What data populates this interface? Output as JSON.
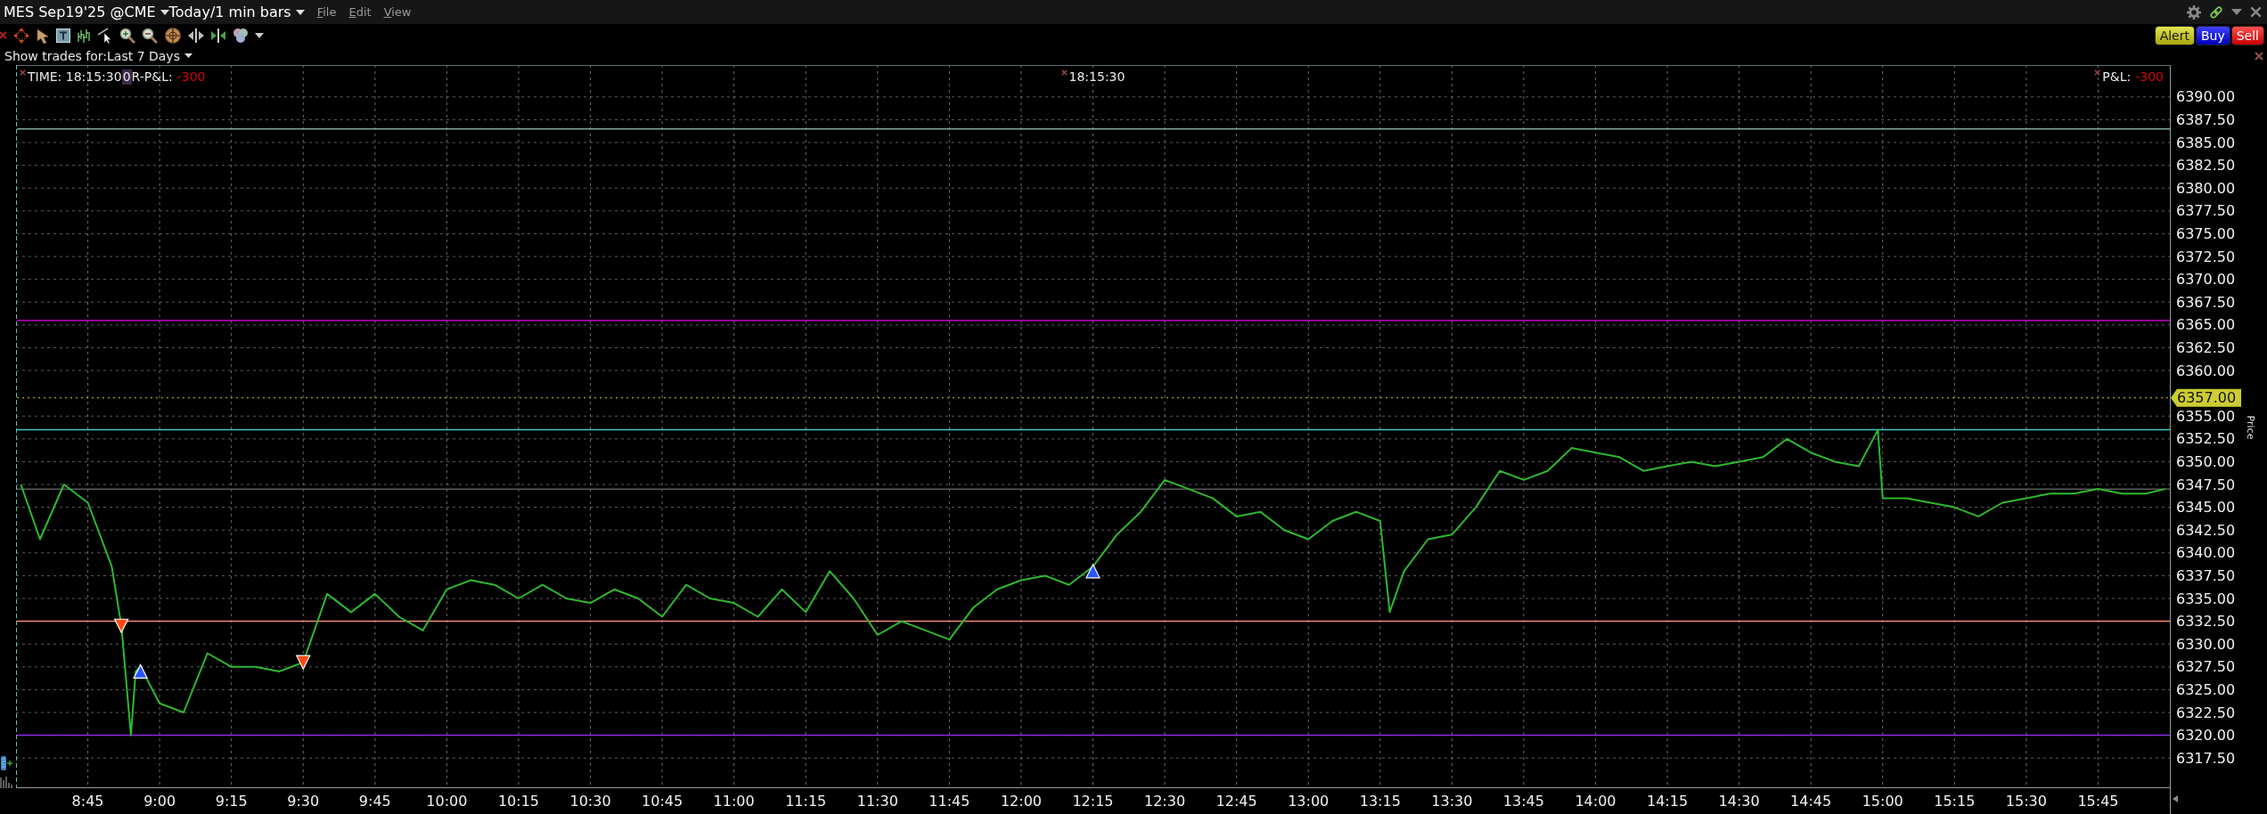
{
  "title_bar": {
    "instrument": "MES Sep19'25 @CME",
    "period": "Today/1 min bars",
    "menu": [
      "File",
      "Edit",
      "View"
    ]
  },
  "order_buttons": [
    {
      "label": "Alert",
      "kind": "alert"
    },
    {
      "label": "Buy",
      "kind": "buy"
    },
    {
      "label": "Sell",
      "kind": "sell"
    }
  ],
  "trades_filter": {
    "label": "Show trades for:",
    "value": "Last 7 Days"
  },
  "chart": {
    "readout_left": {
      "time": "TIME: 18:15:30",
      "badge": "0",
      "label": "R-P&L:",
      "value": "-300"
    },
    "readout_center": {
      "time": "18:15:30"
    },
    "readout_right": {
      "label": "P&L:",
      "value": "-300"
    },
    "axis_title": "Price",
    "chart_data": {
      "type": "line",
      "grid": true,
      "x": [
        511,
        515,
        520,
        525,
        530,
        532,
        534,
        535,
        536,
        540,
        545,
        550,
        555,
        560,
        565,
        570,
        575,
        580,
        585,
        590,
        595,
        600,
        605,
        610,
        615,
        620,
        625,
        630,
        635,
        640,
        645,
        650,
        655,
        660,
        665,
        670,
        675,
        680,
        685,
        690,
        695,
        700,
        705,
        710,
        715,
        720,
        725,
        730,
        735,
        740,
        745,
        750,
        755,
        760,
        765,
        770,
        775,
        780,
        785,
        790,
        795,
        797,
        800,
        805,
        810,
        815,
        820,
        825,
        830,
        835,
        840,
        845,
        850,
        855,
        860,
        865,
        870,
        875,
        880,
        885,
        890,
        895,
        899,
        900,
        905,
        910,
        915,
        920,
        925,
        930,
        935,
        940,
        945,
        950,
        955,
        959
      ],
      "series": [
        {
          "color": "#2eb82e",
          "values": [
            6347.5,
            6341.5,
            6347.5,
            6345.5,
            6338.5,
            6332.0,
            6320.0,
            6327.0,
            6327.5,
            6323.5,
            6322.5,
            6329.0,
            6327.5,
            6327.5,
            6327.0,
            6328.0,
            6335.5,
            6333.5,
            6335.5,
            6333.0,
            6331.5,
            6336.0,
            6337.0,
            6336.5,
            6335.0,
            6336.5,
            6335.0,
            6334.5,
            6336.0,
            6335.0,
            6333.0,
            6336.5,
            6335.0,
            6334.5,
            6333.0,
            6336.0,
            6333.5,
            6338.0,
            6335.0,
            6331.0,
            6332.5,
            6331.5,
            6330.5,
            6334.0,
            6336.0,
            6337.0,
            6337.5,
            6336.5,
            6338.5,
            6342.0,
            6344.5,
            6348.0,
            6347.0,
            6346.0,
            6344.0,
            6344.5,
            6342.5,
            6341.5,
            6343.5,
            6344.5,
            6343.5,
            6333.5,
            6338.0,
            6341.5,
            6342.0,
            6345.0,
            6349.0,
            6348.0,
            6349.0,
            6351.5,
            6351.0,
            6350.5,
            6349.0,
            6349.5,
            6350.0,
            6349.5,
            6350.0,
            6350.5,
            6352.5,
            6351.0,
            6350.0,
            6349.5,
            6353.5,
            6346.0,
            6346.0,
            6345.5,
            6345.0,
            6344.0,
            6345.5,
            6346.0,
            6346.5,
            6346.5,
            6347.0,
            6346.5,
            6346.5,
            6347.0
          ]
        },
        {
          "type": "scatter",
          "marker": "triangle-down",
          "color": "#ff4a12",
          "values": [
            null,
            null,
            null,
            null,
            null,
            6332.0,
            null,
            null,
            null,
            null,
            null,
            null,
            null,
            null,
            null,
            6328.0,
            null,
            null,
            null,
            null,
            null,
            null,
            null,
            null,
            null,
            null,
            null,
            null,
            null,
            null,
            null,
            null,
            null,
            null,
            null,
            null,
            null,
            null,
            null,
            null,
            null,
            null,
            null,
            null,
            null,
            null,
            null,
            null,
            null,
            null,
            null,
            null,
            null,
            null,
            null,
            null,
            null,
            null,
            null,
            null,
            null,
            null,
            null,
            null,
            null,
            null,
            null,
            null,
            null,
            null,
            null,
            null,
            null,
            null,
            null,
            null,
            null,
            null,
            null,
            null,
            null,
            null,
            null,
            null,
            null,
            null,
            null,
            null,
            null,
            null,
            null,
            null,
            null,
            null,
            null,
            null
          ]
        },
        {
          "type": "scatter",
          "marker": "triangle-up",
          "color": "#2a55ff",
          "values": [
            null,
            null,
            null,
            null,
            null,
            null,
            null,
            null,
            6327.0,
            null,
            null,
            null,
            null,
            null,
            null,
            null,
            null,
            null,
            null,
            null,
            null,
            null,
            null,
            null,
            null,
            null,
            null,
            null,
            null,
            null,
            null,
            null,
            null,
            null,
            null,
            null,
            null,
            null,
            null,
            null,
            null,
            null,
            null,
            null,
            null,
            null,
            null,
            null,
            6338.0,
            null,
            null,
            null,
            null,
            null,
            null,
            null,
            null,
            null,
            null,
            null,
            null,
            null,
            null,
            null,
            null,
            null,
            null,
            null,
            null,
            null,
            null,
            null,
            null,
            null,
            null,
            null,
            null,
            null,
            null,
            null,
            null,
            null,
            null,
            null,
            null,
            null,
            null,
            null,
            null,
            null,
            null,
            null,
            null,
            null,
            null,
            null
          ]
        }
      ],
      "xlim": [
        510,
        960
      ],
      "ylim": [
        6314.2,
        6393.5
      ],
      "xticks": [
        {
          "value": 525,
          "label": "8:45"
        },
        {
          "value": 540,
          "label": "9:00"
        },
        {
          "value": 555,
          "label": "9:15"
        },
        {
          "value": 570,
          "label": "9:30"
        },
        {
          "value": 585,
          "label": "9:45"
        },
        {
          "value": 600,
          "label": "10:00"
        },
        {
          "value": 615,
          "label": "10:15"
        },
        {
          "value": 630,
          "label": "10:30"
        },
        {
          "value": 645,
          "label": "10:45"
        },
        {
          "value": 660,
          "label": "11:00"
        },
        {
          "value": 675,
          "label": "11:15"
        },
        {
          "value": 690,
          "label": "11:30"
        },
        {
          "value": 705,
          "label": "11:45"
        },
        {
          "value": 720,
          "label": "12:00"
        },
        {
          "value": 735,
          "label": "12:15"
        },
        {
          "value": 750,
          "label": "12:30"
        },
        {
          "value": 765,
          "label": "12:45"
        },
        {
          "value": 780,
          "label": "13:00"
        },
        {
          "value": 795,
          "label": "13:15"
        },
        {
          "value": 810,
          "label": "13:30"
        },
        {
          "value": 825,
          "label": "13:45"
        },
        {
          "value": 840,
          "label": "14:00"
        },
        {
          "value": 855,
          "label": "14:15"
        },
        {
          "value": 870,
          "label": "14:30"
        },
        {
          "value": 885,
          "label": "14:45"
        },
        {
          "value": 900,
          "label": "15:00"
        },
        {
          "value": 915,
          "label": "15:15"
        },
        {
          "value": 930,
          "label": "15:30"
        },
        {
          "value": 945,
          "label": "15:45"
        }
      ],
      "yticks": [
        {
          "value": 6317.5,
          "label": "6317.50"
        },
        {
          "value": 6320,
          "label": "6320.00"
        },
        {
          "value": 6322.5,
          "label": "6322.50"
        },
        {
          "value": 6325,
          "label": "6325.00"
        },
        {
          "value": 6327.5,
          "label": "6327.50"
        },
        {
          "value": 6330,
          "label": "6330.00"
        },
        {
          "value": 6332.5,
          "label": "6332.50"
        },
        {
          "value": 6335,
          "label": "6335.00"
        },
        {
          "value": 6337.5,
          "label": "6337.50"
        },
        {
          "value": 6340,
          "label": "6340.00"
        },
        {
          "value": 6342.5,
          "label": "6342.50"
        },
        {
          "value": 6345,
          "label": "6345.00"
        },
        {
          "value": 6347.5,
          "label": "6347.50"
        },
        {
          "value": 6350,
          "label": "6350.00"
        },
        {
          "value": 6352.5,
          "label": "6352.50"
        },
        {
          "value": 6355,
          "label": "6355.00"
        },
        {
          "value": 6360,
          "label": "6360.00"
        },
        {
          "value": 6362.5,
          "label": "6362.50"
        },
        {
          "value": 6365,
          "label": "6365.00"
        },
        {
          "value": 6367.5,
          "label": "6367.50"
        },
        {
          "value": 6370,
          "label": "6370.00"
        },
        {
          "value": 6372.5,
          "label": "6372.50"
        },
        {
          "value": 6375,
          "label": "6375.00"
        },
        {
          "value": 6377.5,
          "label": "6377.50"
        },
        {
          "value": 6380,
          "label": "6380.00"
        },
        {
          "value": 6382.5,
          "label": "6382.50"
        },
        {
          "value": 6385,
          "label": "6385.00"
        },
        {
          "value": 6387.5,
          "label": "6387.50"
        },
        {
          "value": 6390,
          "label": "6390.00"
        }
      ],
      "ref_lines": [
        {
          "axis": "y",
          "value": 6386.5,
          "color": "#7fa89a"
        },
        {
          "axis": "y",
          "value": 6365.5,
          "color": "#c000c0"
        },
        {
          "axis": "y",
          "value": 6357,
          "color": "#cccc33",
          "label": "6357.00"
        },
        {
          "axis": "y",
          "value": 6353.5,
          "color": "#40c8c8"
        },
        {
          "axis": "y",
          "value": 6347,
          "color": "#5a5a5a"
        },
        {
          "axis": "y",
          "value": 6332.5,
          "color": "#f08878"
        },
        {
          "axis": "y",
          "value": 6320,
          "color": "#8a2be2"
        }
      ]
    }
  }
}
